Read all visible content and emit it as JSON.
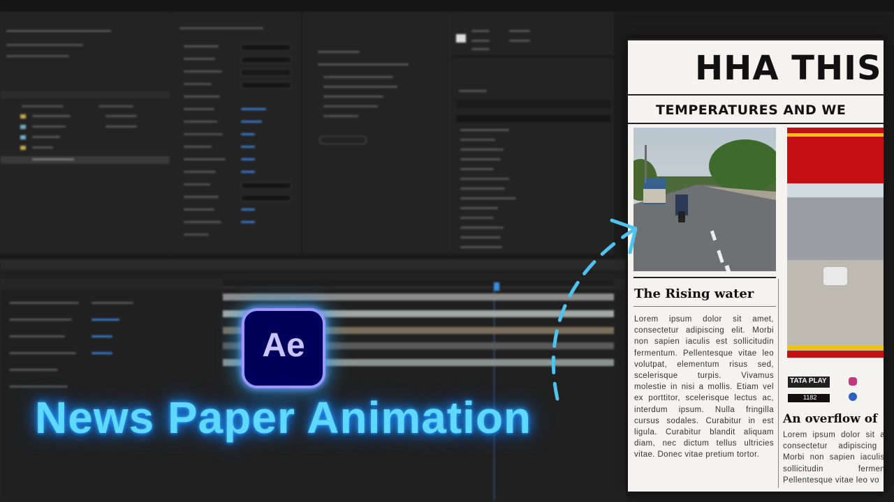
{
  "app": {
    "name": "After Effects",
    "logo_text": "Ae"
  },
  "overlay": {
    "title": "News Paper Animation"
  },
  "newspaper": {
    "masthead": "HHA THIS",
    "subhead": "TEMPERATURES AND WE",
    "story1": {
      "headline": "The Rising water",
      "body": "Lorem ipsum dolor sit amet, consectetur adipiscing elit. Morbi non sapien iaculis est sollicitudin fermentum. Pellentesque vitae leo volutpat, elementum risus sed, scelerisque turpis. Vivamus molestie in nisi a mollis. Etiam vel ex porttitor, scelerisque lectus ac, interdum ipsum. Nulla fringilla cursus sodales. Curabitur in est ligula. Curabitur blandit aliquam diam, nec dictum tellus ultricies vitae. Donec vitae pretium tortor."
    },
    "story2": {
      "headline": "An overflow of",
      "body": "Lorem ipsum dolor sit amet, consectetur adipiscing elit. Morbi non sapien iaculis est sollicitudin fermentum. Pellentesque vitae leo vo"
    },
    "tv_badge": {
      "brand": "TATA PLAY",
      "channel": "1182"
    }
  },
  "colors": {
    "accent": "#5fd8ff",
    "logo_bg": "#00005b",
    "logo_border": "#9a98ff",
    "arrow": "#4fc3ee",
    "news_red": "#c40f12"
  },
  "icons": [
    "dashed-arrow-icon",
    "instagram-icon",
    "facebook-icon"
  ]
}
